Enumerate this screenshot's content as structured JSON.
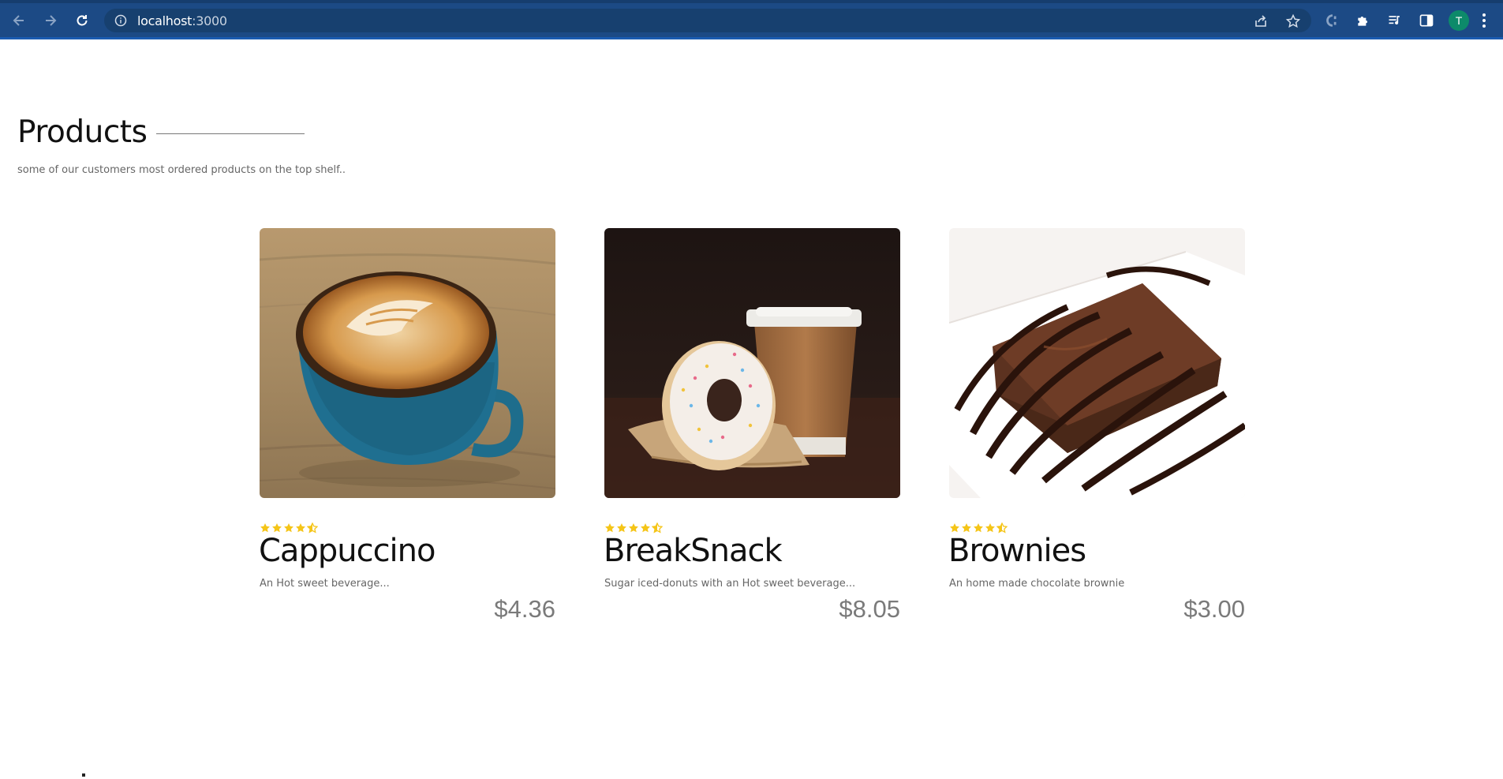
{
  "browser": {
    "url_host": "localhost",
    "url_port": ":3000",
    "profile_initial": "T",
    "icons": [
      "back-arrow-icon",
      "forward-arrow-icon",
      "reload-icon",
      "info-icon",
      "share-icon",
      "star-icon",
      "extension-c-icon",
      "puzzle-icon",
      "media-queue-icon",
      "side-panel-icon",
      "more-vert-icon"
    ]
  },
  "section": {
    "title": "Products",
    "subtitle": "some of our customers most ordered products on the top shelf.."
  },
  "products": [
    {
      "name": "Cappuccino",
      "description": "An Hot sweet beverage...",
      "price": "$4.36",
      "rating": 4.5
    },
    {
      "name": "BreakSnack",
      "description": "Sugar iced-donuts with an Hot sweet beverage...",
      "price": "$8.05",
      "rating": 4.5
    },
    {
      "name": "Brownies",
      "description": "An home made chocolate brownie",
      "price": "$3.00",
      "rating": 4.5
    }
  ],
  "colors": {
    "chrome_bg": "#1c4a85",
    "star": "#f5c518",
    "price": "#7a7a7a",
    "avatar": "#0d8a6a"
  }
}
